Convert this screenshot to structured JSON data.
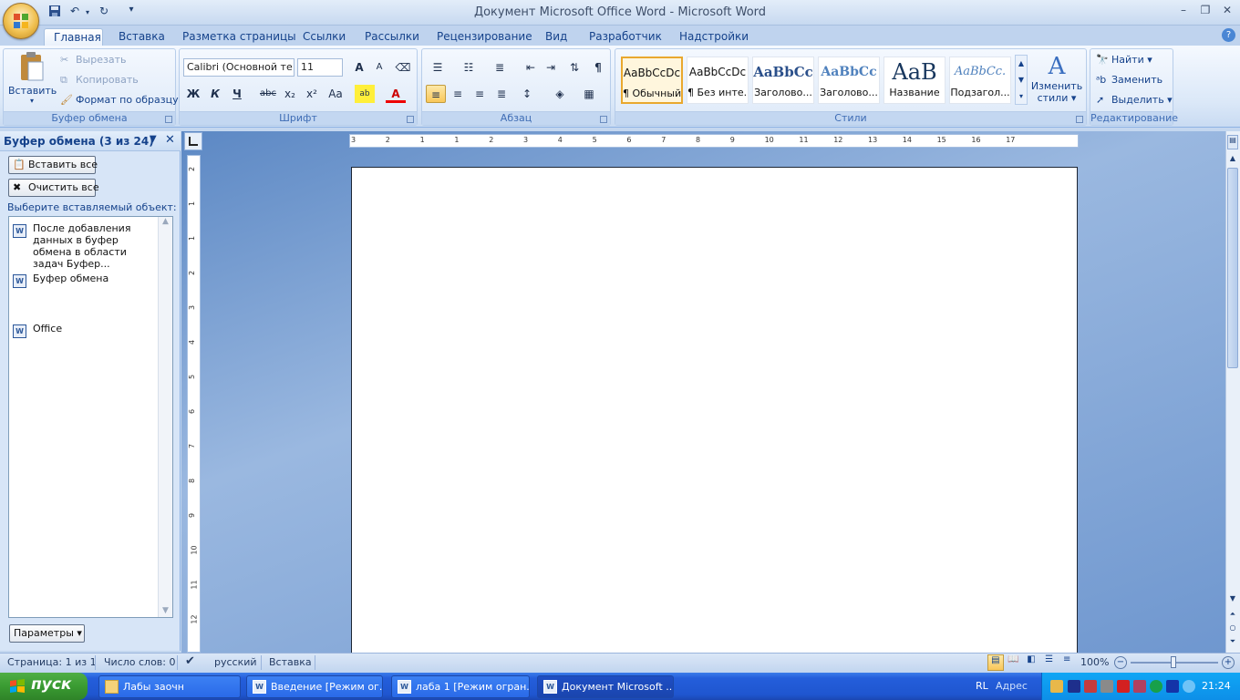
{
  "window": {
    "title": "Документ Microsoft Office Word - Microsoft Word"
  },
  "qat": {
    "save": "save-icon",
    "undo": "undo-icon",
    "redo": "redo-icon",
    "more": "▾"
  },
  "tabs": [
    "Главная",
    "Вставка",
    "Разметка страницы",
    "Ссылки",
    "Рассылки",
    "Рецензирование",
    "Вид",
    "Разработчик",
    "Надстройки"
  ],
  "ribbon": {
    "clipboard": {
      "label": "Буфер обмена",
      "paste": "Вставить",
      "cut": "Вырезать",
      "copy": "Копировать",
      "format_painter": "Формат по образцу"
    },
    "font": {
      "label": "Шрифт",
      "font_name": "Calibri (Основной те",
      "font_size": "11",
      "bold": "Ж",
      "italic": "К",
      "underline": "Ч",
      "strike": "abc",
      "sub": "x₂",
      "sup": "x²",
      "case": "Aa",
      "grow": "A",
      "shrink": "A"
    },
    "paragraph": {
      "label": "Абзац"
    },
    "styles": {
      "label": "Стили",
      "items": [
        {
          "sample": "AaBbCcDc",
          "name": "¶ Обычный"
        },
        {
          "sample": "AaBbCcDc",
          "name": "¶ Без инте..."
        },
        {
          "sample": "AaBbCc",
          "name": "Заголово..."
        },
        {
          "sample": "AaBbCc",
          "name": "Заголово..."
        },
        {
          "sample": "AaB",
          "name": "Название"
        },
        {
          "sample": "AaBbCc.",
          "name": "Подзагол..."
        }
      ],
      "change": "Изменить",
      "change2": "стили"
    },
    "editing": {
      "label": "Редактирование",
      "find": "Найти",
      "replace": "Заменить",
      "select": "Выделить"
    }
  },
  "pane": {
    "title": "Буфер обмена (3 из 24)",
    "paste_all": "Вставить все",
    "clear_all": "Очистить все",
    "prompt": "Выберите вставляемый объект:",
    "items": [
      "После добавления данных в буфер обмена в области задач Буфер...",
      "Буфер обмена",
      "Office"
    ],
    "options": "Параметры"
  },
  "hruler_ticks": [
    "3",
    "2",
    "1",
    "1",
    "2",
    "3",
    "4",
    "5",
    "6",
    "7",
    "8",
    "9",
    "10",
    "11",
    "12",
    "13",
    "14",
    "15",
    "16",
    "17"
  ],
  "vruler_ticks": [
    "2",
    "1",
    "1",
    "2",
    "3",
    "4",
    "5",
    "6",
    "7",
    "8",
    "9",
    "10",
    "11",
    "12"
  ],
  "status": {
    "page": "Страница: 1 из 1",
    "words": "Число слов: 0",
    "lang": "русский",
    "mode": "Вставка",
    "zoom": "100%"
  },
  "taskbar": {
    "start": "пуск",
    "tasks": [
      "Лабы заочн",
      "Введение [Режим ог...",
      "лаба 1 [Режим огран...",
      "Документ Microsoft ..."
    ],
    "lang": "RL",
    "address": "Адрес",
    "time": "21:24"
  }
}
